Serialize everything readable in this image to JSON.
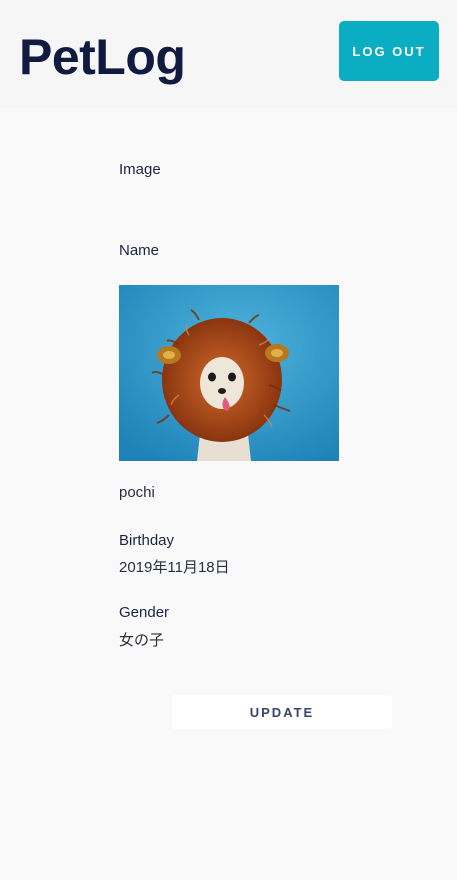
{
  "header": {
    "brand": "PetLog",
    "logout_label": "LOG OUT"
  },
  "form": {
    "image_label": "Image",
    "name_label": "Name",
    "name_value": "pochi",
    "birthday_label": "Birthday",
    "birthday_value": "2019年11月18日",
    "gender_label": "Gender",
    "gender_value": "女の子",
    "update_label": "UPDATE"
  },
  "colors": {
    "brand_text": "#111a3f",
    "accent": "#0badc2",
    "background": "#f9f9f9"
  }
}
